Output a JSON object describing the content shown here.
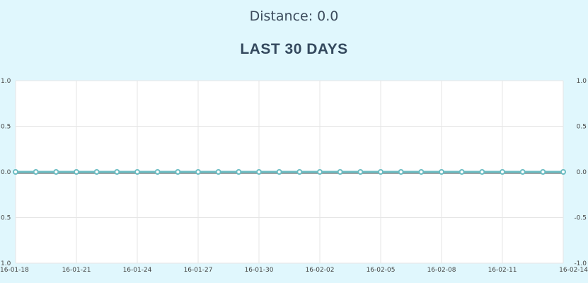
{
  "header": {
    "distance_text": "Distance: 0.0",
    "title": "LAST 30 DAYS"
  },
  "chart_data": {
    "type": "line",
    "x": [
      "16-01-18",
      "16-01-19",
      "16-01-20",
      "16-01-21",
      "16-01-22",
      "16-01-23",
      "16-01-24",
      "16-01-25",
      "16-01-26",
      "16-01-27",
      "16-01-28",
      "16-01-29",
      "16-01-30",
      "16-01-31",
      "16-02-01",
      "16-02-02",
      "16-02-03",
      "16-02-04",
      "16-02-05",
      "16-02-06",
      "16-02-07",
      "16-02-08",
      "16-02-09",
      "16-02-10",
      "16-02-11",
      "16-02-12",
      "16-02-13",
      "16-02-14"
    ],
    "x_tick_labels": [
      "16-01-18",
      "16-01-21",
      "16-01-24",
      "16-01-27",
      "16-01-30",
      "16-02-02",
      "16-02-05",
      "16-02-08",
      "16-02-11",
      "16-02-14"
    ],
    "series": [
      {
        "values": [
          0,
          0,
          0,
          0,
          0,
          0,
          0,
          0,
          0,
          0,
          0,
          0,
          0,
          0,
          0,
          0,
          0,
          0,
          0,
          0,
          0,
          0,
          0,
          0,
          0,
          0,
          0,
          0
        ],
        "color": "#6bbcc2"
      }
    ],
    "ylim": [
      -1.0,
      1.0
    ],
    "y_tick_labels_left": [
      "1.0",
      "0.5",
      "0.0",
      "0.5",
      "1.0"
    ],
    "y_tick_labels_right": [
      "1.0",
      "0.5",
      "0.0",
      "-0.5",
      "-1.0"
    ],
    "grid": true,
    "plot_background": "#ffffff",
    "baseline_color": "#888888"
  }
}
